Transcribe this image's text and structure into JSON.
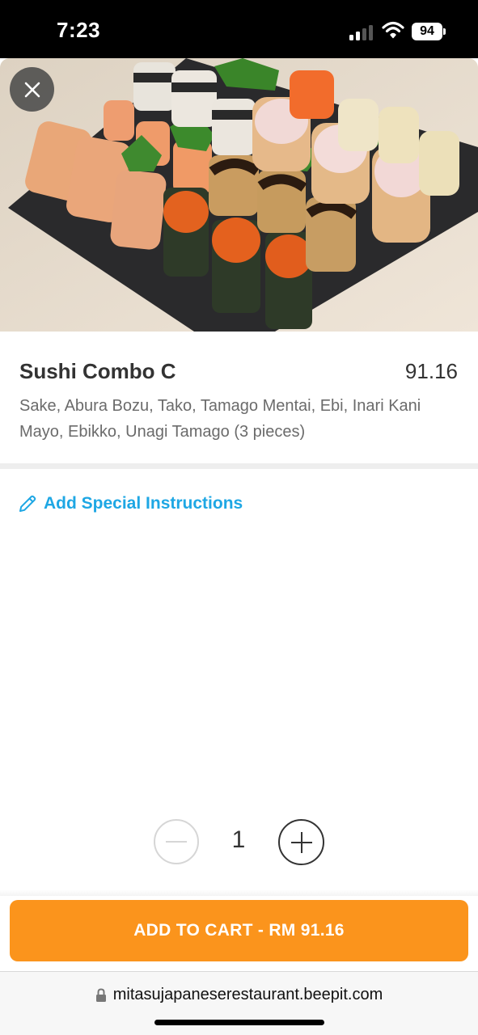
{
  "status_bar": {
    "time": "7:23",
    "battery": "94",
    "icons": [
      "signal-icon",
      "wifi-icon",
      "battery-icon"
    ]
  },
  "hero": {
    "close_icon": "close-icon"
  },
  "product": {
    "name": "Sushi Combo C",
    "price": "91.16",
    "description": "Sake, Abura Bozu, Tako, Tamago Mentai, Ebi, Inari Kani Mayo, Ebikko, Unagi Tamago (3 pieces)"
  },
  "instructions": {
    "label": "Add Special Instructions",
    "icon": "pencil-icon",
    "color": "#1ea7e4"
  },
  "quantity": {
    "value": "1",
    "minus_icon": "minus-icon",
    "plus_icon": "plus-icon"
  },
  "cart": {
    "label": "ADD TO CART - RM 91.16",
    "color": "#fb941c"
  },
  "browser": {
    "url": "mitasujapaneserestaurant.beepit.com",
    "lock_icon": "lock-icon"
  }
}
